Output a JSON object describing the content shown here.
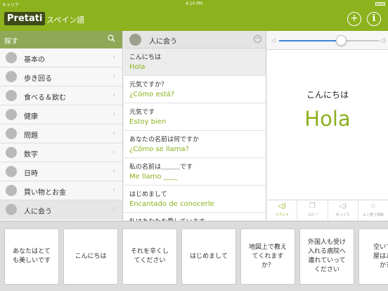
{
  "status": {
    "carrier": "キャリア",
    "time": "4:10 PM"
  },
  "header": {
    "logo": "Pretati",
    "language": "スペイン語",
    "add_symbol": "+",
    "info_symbol": "i"
  },
  "search": {
    "placeholder": "探す"
  },
  "categories": [
    {
      "label": "基本の",
      "icon": "pen-icon"
    },
    {
      "label": "歩き回る",
      "icon": "walk-icon"
    },
    {
      "label": "食べる＆飲む",
      "icon": "drink-icon"
    },
    {
      "label": "健康",
      "icon": "health-icon"
    },
    {
      "label": "問題",
      "icon": "face-icon"
    },
    {
      "label": "数字",
      "icon": "numbers-icon"
    },
    {
      "label": "日時",
      "icon": "clock-icon"
    },
    {
      "label": "買い物とお金",
      "icon": "bag-icon"
    },
    {
      "label": "人に会う",
      "icon": "people-icon",
      "active": true
    }
  ],
  "list": {
    "title": "人に会う",
    "phrases": [
      {
        "jp": "こんにちは",
        "es": "Hola",
        "selected": true
      },
      {
        "jp": "元気ですか？",
        "es": "¿Cómo está?"
      },
      {
        "jp": "元気です",
        "es": "Estoy bien"
      },
      {
        "jp": "あなたの名前は何ですか",
        "es": "¿Cómo se llama?"
      },
      {
        "jp": "私の名前は＿＿＿です",
        "es": "Me llamo ____"
      },
      {
        "jp": "はじめまして",
        "es": "Encantado de conocerle"
      },
      {
        "jp": "私はあなたを愛しています",
        "es": ""
      }
    ]
  },
  "detail": {
    "jp": "こんにちは",
    "es": "Hola",
    "volume": 0.62,
    "actions": [
      {
        "label": "リプレイ",
        "icon": "speaker-icon",
        "active": true
      },
      {
        "label": "コピー",
        "icon": "copy-icon"
      },
      {
        "label": "ゆっくり",
        "icon": "slow-speaker-icon"
      },
      {
        "label": "よく使う項目",
        "icon": "star-icon"
      }
    ]
  },
  "cards": [
    "あなたはとて\nも美しいです",
    "こんにちは",
    "それを辛くし\nてください",
    "はじめまして",
    "地図上で教え\nてくれます\nか？",
    "外国人も受け\n入れる病院へ\n連れていって\nください",
    "空いてい\n屋はあり\nか？"
  ],
  "colors": {
    "brand": "#8cb21e",
    "search_bar": "#8fa858",
    "accent_blue": "#3d82d6"
  }
}
